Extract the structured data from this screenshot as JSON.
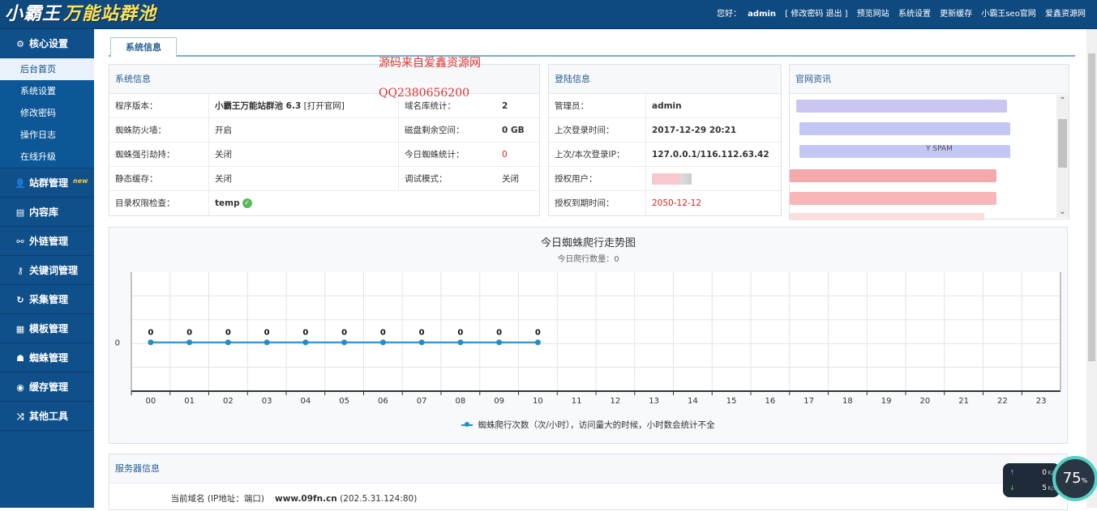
{
  "header": {
    "logo_part1": "小霸王",
    "logo_part2": "万能站群池",
    "greeting": "您好：",
    "user": "admin",
    "links": [
      "[ 修改密码 退出 ]",
      "预览网站",
      "系统设置",
      "更新缓存",
      "小霸王seo官网",
      "爱鑫资源网"
    ]
  },
  "sidebar": {
    "core": {
      "label": "核心设置",
      "icon": "gear-icon"
    },
    "core_items": [
      "后台首页",
      "系统设置",
      "修改密码",
      "操作日志",
      "在线升级"
    ],
    "groups": [
      {
        "label": "站群管理",
        "icon": "user-icon",
        "badge": "new"
      },
      {
        "label": "内容库",
        "icon": "list-icon"
      },
      {
        "label": "外链管理",
        "icon": "link-icon"
      },
      {
        "label": "关键词管理",
        "icon": "key-icon"
      },
      {
        "label": "采集管理",
        "icon": "refresh-icon"
      },
      {
        "label": "模板管理",
        "icon": "windows-icon"
      },
      {
        "label": "蜘蛛管理",
        "icon": "android-icon"
      },
      {
        "label": "缓存管理",
        "icon": "cache-icon"
      },
      {
        "label": "其他工具",
        "icon": "shuffle-icon"
      }
    ]
  },
  "tab": {
    "label": "系统信息"
  },
  "watermark": {
    "line1": "源码来自爱鑫资源网",
    "line2": "QQ2380656200"
  },
  "sysinfo": {
    "title": "系统信息",
    "rows": [
      {
        "k1": "程序版本：",
        "v1": "小霸王万能站群池 6.3",
        "v1b": " [打开官网]",
        "k2": "域名库统计：",
        "v2": "2"
      },
      {
        "k1": "蜘蛛防火墙：",
        "v1": "开启",
        "k2": "磁盘剩余空间：",
        "v2": "0 GB"
      },
      {
        "k1": "蜘蛛强引劫持：",
        "v1": "关闭",
        "k2": "今日蜘蛛统计：",
        "v2": "0"
      },
      {
        "k1": "静态缓存：",
        "v1": "关闭",
        "k2": "调试模式：",
        "v2": "关闭"
      },
      {
        "k1": "目录权限检查：",
        "v1": "temp"
      }
    ]
  },
  "login": {
    "title": "登陆信息",
    "rows": [
      {
        "k": "管理员：",
        "v": "admin"
      },
      {
        "k": "上次登录时间：",
        "v": "2017-12-29 20:21"
      },
      {
        "k": "上次/本次登录IP：",
        "v": "127.0.0.1/116.112.63.42"
      },
      {
        "k": "授权用户：",
        "v": ""
      },
      {
        "k": "授权到期时间：",
        "v": "2050-12-12"
      }
    ]
  },
  "news": {
    "title": "官网资讯",
    "blurred_text": "Y SPAM"
  },
  "chart_data": {
    "type": "line",
    "title": "今日蜘蛛爬行走势图",
    "subtitle": "今日爬行数量：0",
    "categories": [
      "00",
      "01",
      "02",
      "03",
      "04",
      "05",
      "06",
      "07",
      "08",
      "09",
      "10",
      "11",
      "12",
      "13",
      "14",
      "15",
      "16",
      "17",
      "18",
      "19",
      "20",
      "21",
      "22",
      "23"
    ],
    "series": [
      {
        "name": "蜘蛛爬行次数（次/小时），访问量大的时候，小时数会统计不全",
        "values": [
          0,
          0,
          0,
          0,
          0,
          0,
          0,
          0,
          0,
          0,
          0
        ]
      }
    ],
    "yticks": [
      "0"
    ],
    "color": "#1f8fc9",
    "grid": true,
    "legend": "bottom"
  },
  "server": {
    "title": "服务器信息",
    "row_key": "当前域名 (IP地址：端口)",
    "row_val": "www.09fn.cn",
    "row_val2": " (202.5.31.124:80)"
  },
  "net": {
    "up": "0",
    "down": "5",
    "unit": "K/s",
    "percent": "75",
    "percent_sign": "%"
  }
}
